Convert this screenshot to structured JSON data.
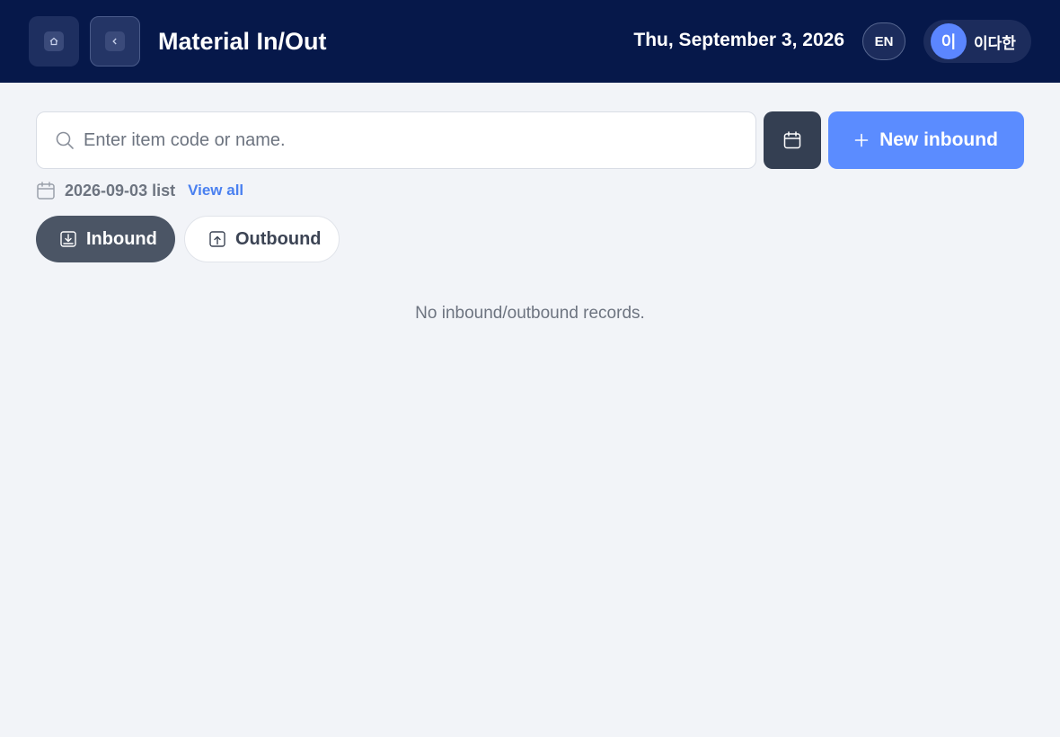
{
  "header": {
    "title": "Material In/Out",
    "date": "Thu, September 3, 2026",
    "language": "EN",
    "user": {
      "avatar_initial": "이",
      "name": "이다한"
    },
    "home_icon": "home-icon",
    "back_icon": "chevron-left-icon"
  },
  "search": {
    "placeholder": "Enter item code or name.",
    "value": "",
    "icon": "search-icon"
  },
  "toolbar": {
    "calendar_icon": "calendar-icon",
    "new_inbound_label": "New inbound"
  },
  "filter": {
    "date_list_label": "2026-09-03 list",
    "view_all_label": "View all"
  },
  "tabs": [
    {
      "label": "Inbound",
      "active": true,
      "icon": "inbound-tray-icon"
    },
    {
      "label": "Outbound",
      "active": false,
      "icon": "outbound-tray-icon"
    }
  ],
  "empty_message": "No inbound/outbound records.",
  "colors": {
    "header_bg": "#06184a",
    "accent": "#5b8cff",
    "link": "#4a80f0",
    "active_tab": "#4b5565",
    "page_bg": "#f2f4f8"
  }
}
